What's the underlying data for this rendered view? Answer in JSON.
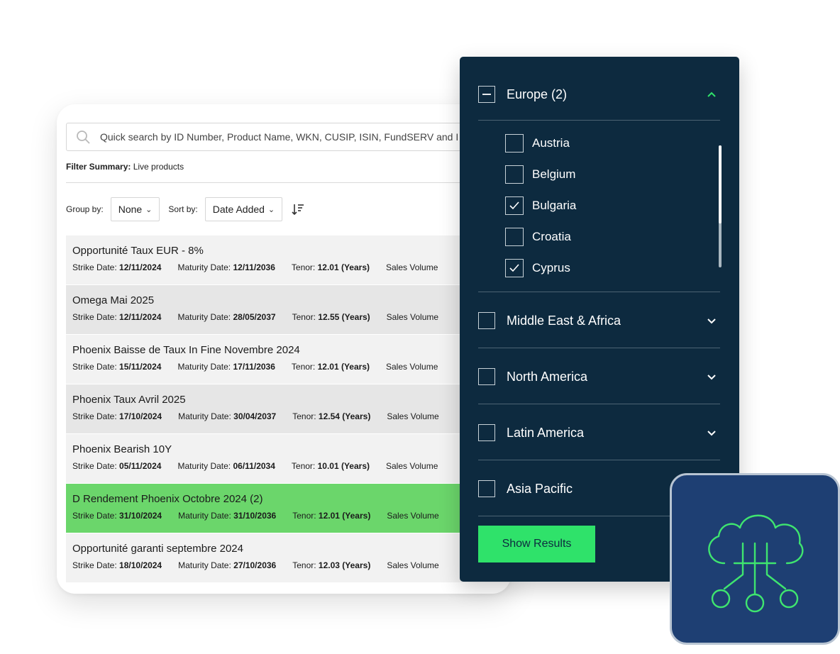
{
  "search": {
    "placeholder": "Quick search by ID Number, Product Name, WKN, CUSIP, ISIN, FundSERV and I"
  },
  "filter_summary": {
    "label": "Filter Summary:",
    "value": "Live products"
  },
  "toolbar": {
    "group_by_label": "Group by:",
    "group_by_value": "None",
    "sort_by_label": "Sort by:",
    "sort_by_value": "Date Added"
  },
  "product_fields": {
    "strike_label": "Strike Date:",
    "maturity_label": "Maturity Date:",
    "tenor_label": "Tenor:",
    "sales_label": "Sales Volume"
  },
  "products": [
    {
      "name": "Opportunité Taux EUR - 8%",
      "strike": "12/11/2024",
      "maturity": "12/11/2036",
      "tenor": "12.01 (Years)"
    },
    {
      "name": "Omega Mai 2025",
      "strike": "12/11/2024",
      "maturity": "28/05/2037",
      "tenor": "12.55 (Years)"
    },
    {
      "name": "Phoenix Baisse de Taux In Fine Novembre 2024",
      "strike": "15/11/2024",
      "maturity": "17/11/2036",
      "tenor": "12.01 (Years)"
    },
    {
      "name": "Phoenix Taux Avril 2025",
      "strike": "17/10/2024",
      "maturity": "30/04/2037",
      "tenor": "12.54 (Years)"
    },
    {
      "name": "Phoenix Bearish 10Y",
      "strike": "05/11/2024",
      "maturity": "06/11/2034",
      "tenor": "10.01 (Years)"
    },
    {
      "name": "D Rendement Phoenix Octobre 2024 (2)",
      "strike": "31/10/2024",
      "maturity": "31/10/2036",
      "tenor": "12.01 (Years)",
      "highlighted": true
    },
    {
      "name": "Opportunité garanti septembre 2024",
      "strike": "18/10/2024",
      "maturity": "27/10/2036",
      "tenor": "12.03 (Years)"
    }
  ],
  "region_filter": {
    "regions": [
      {
        "label": "Europe (2)",
        "state": "partial",
        "expanded": true
      },
      {
        "label": "Middle East & Africa",
        "state": "unchecked",
        "expanded": false
      },
      {
        "label": "North America",
        "state": "unchecked",
        "expanded": false
      },
      {
        "label": "Latin America",
        "state": "unchecked",
        "expanded": false
      },
      {
        "label": "Asia Pacific",
        "state": "unchecked",
        "expanded": false
      }
    ],
    "countries": [
      {
        "label": "Austria",
        "checked": false
      },
      {
        "label": "Belgium",
        "checked": false
      },
      {
        "label": "Bulgaria",
        "checked": true
      },
      {
        "label": "Croatia",
        "checked": false
      },
      {
        "label": "Cyprus",
        "checked": true
      }
    ],
    "show_results_label": "Show Results"
  },
  "colors": {
    "panel_bg": "#0d2a3f",
    "accent_green": "#2fe26a",
    "row_highlight": "#6bd66b",
    "badge_bg": "#1e3f73"
  },
  "icons": [
    "search-icon",
    "chevron-down-icon",
    "sort-direction-icon",
    "checkmark-icon",
    "minus-icon",
    "chevron-up-icon",
    "cloud-network-icon"
  ]
}
